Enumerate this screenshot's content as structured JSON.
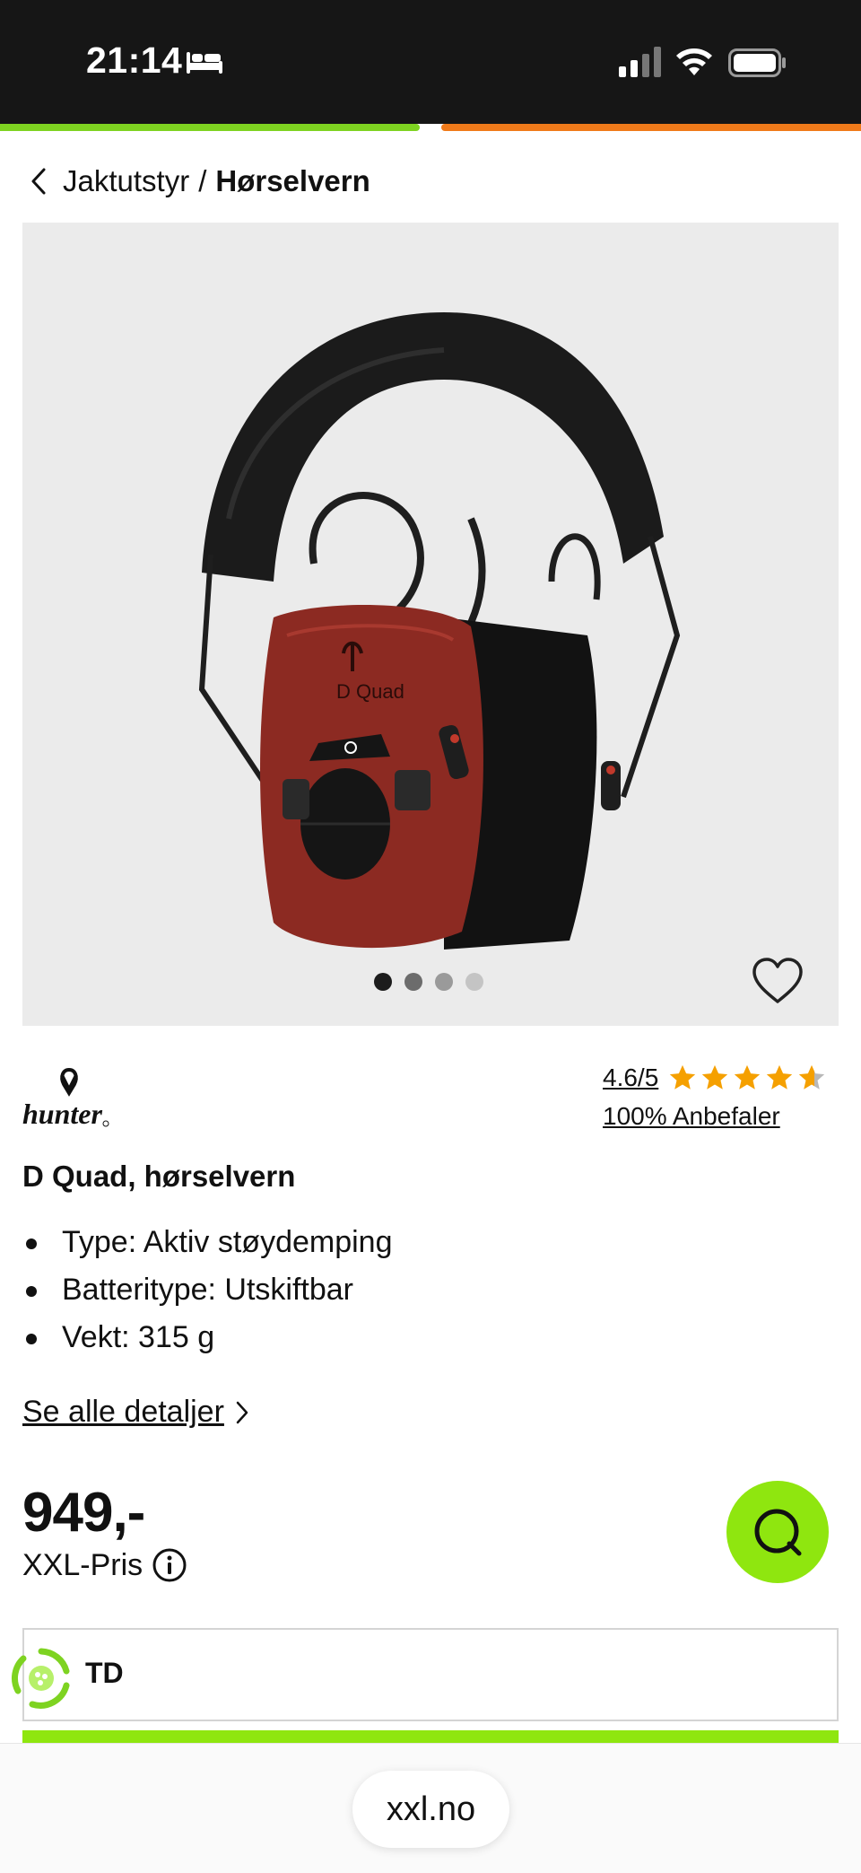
{
  "status_bar": {
    "time": "21:14"
  },
  "breadcrumb": {
    "parent": "Jaktutstyr",
    "separator": "/",
    "current": "Hørselvern"
  },
  "gallery": {
    "image_count": 4,
    "active_index": 0
  },
  "brand": {
    "name": "hunter"
  },
  "rating": {
    "value": "4.6/5",
    "recommend": "100% Anbefaler",
    "stars": 4.6
  },
  "product": {
    "title": "D Quad, hørselvern",
    "specs": [
      "Type: Aktiv støydemping",
      "Batteritype: Utskiftbar",
      "Vekt: 315 g"
    ],
    "details_link": "Se alle detaljer",
    "price": "949,-",
    "price_label": "XXL-Pris"
  },
  "option": {
    "label": "TD"
  },
  "browser": {
    "url": "xxl.no"
  },
  "colors": {
    "accent_green": "#8fe60f",
    "star": "#f5a000",
    "loading_orange": "#f07a1a"
  }
}
